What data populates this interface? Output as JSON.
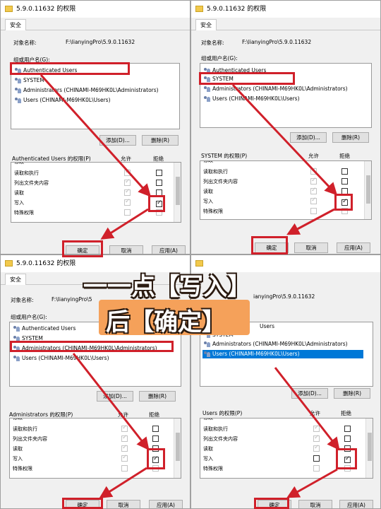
{
  "overlay": {
    "line1": "一一点【写入】",
    "line2": "后【确定】"
  },
  "colors": {
    "highlight": "#d0202a",
    "selection": "#0078d7",
    "overlay_bg": "#f5a15a"
  },
  "panels": [
    {
      "title": "5.9.0.11632 的权限",
      "tab": "安全",
      "object_label": "对象名称:",
      "object_value": "F:\\lianyingPro\\5.9.0.11632",
      "groups_label": "组或用户名(G):",
      "users": [
        "Authenticated Users",
        "SYSTEM",
        "Administrators (CHINAMI-M69HK0L\\Administrators)",
        "Users (CHINAMI-M69HK0L\\Users)"
      ],
      "add_button": "添加(D)...",
      "remove_button": "删除(R)",
      "perm_label": "Authenticated Users 的权限(P)",
      "allow_header": "允许",
      "deny_header": "拒绝",
      "perms": [
        "修改",
        "读取和执行",
        "列出文件夹内容",
        "读取",
        "写入",
        "特殊权限"
      ],
      "ok_button": "确定",
      "cancel_button": "取消",
      "apply_button": "应用(A)"
    },
    {
      "title": "5.9.0.11632 的权限",
      "tab": "安全",
      "object_label": "对象名称:",
      "object_value": "F:\\lianyingPro\\5.9.0.11632",
      "groups_label": "组或用户名(G):",
      "users": [
        "Authenticated Users",
        "SYSTEM",
        "Administrators (CHINAMI-M69HK0L\\Administrators)",
        "Users (CHINAMI-M69HK0L\\Users)"
      ],
      "add_button": "添加(D)...",
      "remove_button": "删除(R)",
      "perm_label": "SYSTEM 的权限(P)",
      "allow_header": "允许",
      "deny_header": "拒绝",
      "perms": [
        "修改",
        "读取和执行",
        "列出文件夹内容",
        "读取",
        "写入",
        "特殊权限"
      ],
      "ok_button": "确定",
      "cancel_button": "取消",
      "apply_button": "应用(A)"
    },
    {
      "title": "5.9.0.11632 的权限",
      "tab": "安全",
      "object_label": "对象名称:",
      "object_value": "F:\\lianyingPro\\5",
      "groups_label": "组或用户名(G):",
      "users": [
        "Authenticated Users",
        "SYSTEM",
        "Administrators (CHINAMI-M69HK0L\\Administrators)",
        "Users (CHINAMI-M69HK0L\\Users)"
      ],
      "add_button": "添加(D)...",
      "remove_button": "删除(R)",
      "perm_label": "Administrators 的权限(P)",
      "allow_header": "允许",
      "deny_header": "拒绝",
      "perms": [
        "修改",
        "读取和执行",
        "列出文件夹内容",
        "读取",
        "写入",
        "特殊权限"
      ],
      "ok_button": "确定",
      "cancel_button": "取消",
      "apply_button": "应用(A)"
    },
    {
      "title": "",
      "tab": "",
      "object_label": "",
      "object_value": "ianyingPro\\5.9.0.11632",
      "groups_label": "",
      "users": [
        "Users",
        "SYSTEM",
        "Administrators (CHINAMI-M69HK0L\\Administrators)",
        "Users (CHINAMI-M69HK0L\\Users)"
      ],
      "add_button": "添加(D)...",
      "remove_button": "删除(R)",
      "perm_label": "Users 的权限(P)",
      "allow_header": "允许",
      "deny_header": "拒绝",
      "perms": [
        "修改",
        "读取和执行",
        "列出文件夹内容",
        "读取",
        "写入",
        "特殊权限"
      ],
      "ok_button": "确定",
      "cancel_button": "取消",
      "apply_button": "应用(A)"
    }
  ]
}
